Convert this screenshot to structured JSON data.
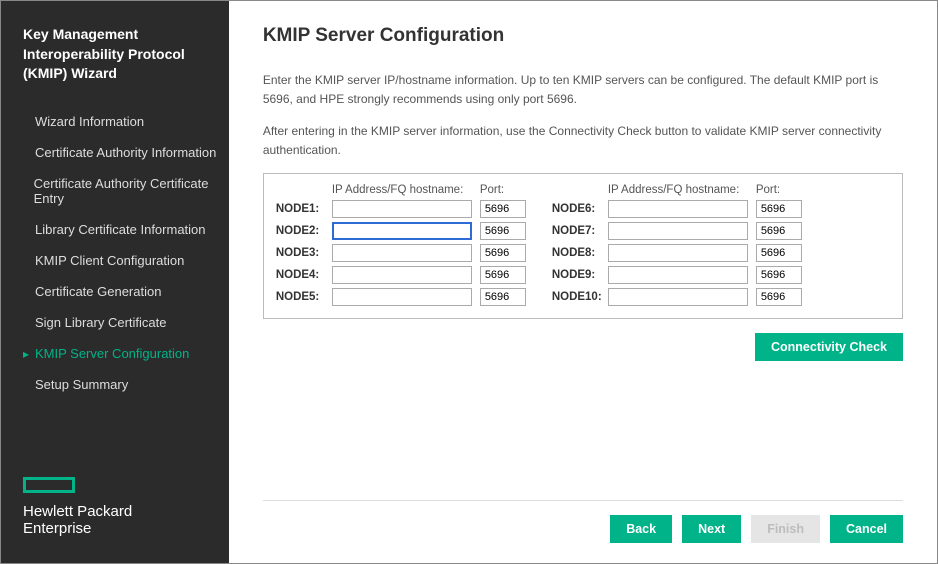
{
  "sidebar": {
    "title_line1": "Key Management Interoperability Protocol",
    "title_line2": "(KMIP) Wizard",
    "items": [
      {
        "label": "Wizard Information",
        "active": false
      },
      {
        "label": "Certificate Authority Information",
        "active": false
      },
      {
        "label": "Certificate Authority Certificate Entry",
        "active": false
      },
      {
        "label": "Library Certificate Information",
        "active": false
      },
      {
        "label": "KMIP Client Configuration",
        "active": false
      },
      {
        "label": "Certificate Generation",
        "active": false
      },
      {
        "label": "Sign Library Certificate",
        "active": false
      },
      {
        "label": "KMIP Server Configuration",
        "active": true
      },
      {
        "label": "Setup Summary",
        "active": false
      }
    ],
    "brand_line1": "Hewlett Packard",
    "brand_line2": "Enterprise"
  },
  "main": {
    "title": "KMIP Server Configuration",
    "para1": "Enter the KMIP server IP/hostname information. Up to ten KMIP servers can be configured. The default KMIP port is 5696, and HPE strongly recommends using only port 5696.",
    "para2": "After entering in the KMIP server information, use the Connectivity Check button to validate KMIP server connectivity authentication.",
    "head_ip": "IP Address/FQ hostname:",
    "head_port": "Port:",
    "nodes_left": [
      {
        "label": "NODE1:",
        "ip": "",
        "port": "5696"
      },
      {
        "label": "NODE2:",
        "ip": "",
        "port": "5696"
      },
      {
        "label": "NODE3:",
        "ip": "",
        "port": "5696"
      },
      {
        "label": "NODE4:",
        "ip": "",
        "port": "5696"
      },
      {
        "label": "NODE5:",
        "ip": "",
        "port": "5696"
      }
    ],
    "nodes_right": [
      {
        "label": "NODE6:",
        "ip": "",
        "port": "5696"
      },
      {
        "label": "NODE7:",
        "ip": "",
        "port": "5696"
      },
      {
        "label": "NODE8:",
        "ip": "",
        "port": "5696"
      },
      {
        "label": "NODE9:",
        "ip": "",
        "port": "5696"
      },
      {
        "label": "NODE10:",
        "ip": "",
        "port": "5696"
      }
    ],
    "connectivity_label": "Connectivity Check",
    "buttons": {
      "back": "Back",
      "next": "Next",
      "finish": "Finish",
      "cancel": "Cancel"
    }
  }
}
